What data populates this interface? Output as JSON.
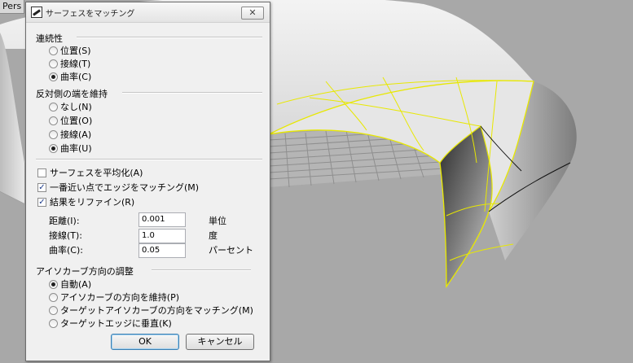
{
  "viewport": {
    "tab_label": "Pers"
  },
  "dialog": {
    "title": "サーフェスをマッチング",
    "close_glyph": "✕",
    "continuity": {
      "heading": "連続性",
      "options": [
        {
          "label": "位置(S)",
          "selected": false
        },
        {
          "label": "接線(T)",
          "selected": false
        },
        {
          "label": "曲率(C)",
          "selected": true
        }
      ]
    },
    "opposite_edge": {
      "heading": "反対側の端を維持",
      "options": [
        {
          "label": "なし(N)",
          "selected": false
        },
        {
          "label": "位置(O)",
          "selected": false
        },
        {
          "label": "接線(A)",
          "selected": false
        },
        {
          "label": "曲率(U)",
          "selected": true
        }
      ]
    },
    "checkboxes": [
      {
        "label": "サーフェスを平均化(A)",
        "checked": false
      },
      {
        "label": "一番近い点でエッジをマッチング(M)",
        "checked": true
      },
      {
        "label": "結果をリファイン(R)",
        "checked": true
      }
    ],
    "refine": {
      "distance": {
        "label": "距離(I):",
        "value": "0.001",
        "unit": "単位"
      },
      "tangent": {
        "label": "接線(T):",
        "value": "1.0",
        "unit": "度"
      },
      "curvature": {
        "label": "曲率(C):",
        "value": "0.05",
        "unit": "パーセント"
      }
    },
    "isocurve": {
      "heading": "アイソカーブ方向の調整",
      "options": [
        {
          "label": "自動(A)",
          "selected": true
        },
        {
          "label": "アイソカーブの方向を維持(P)",
          "selected": false
        },
        {
          "label": "ターゲットアイソカーブの方向をマッチング(M)",
          "selected": false
        },
        {
          "label": "ターゲットエッジに垂直(K)",
          "selected": false
        }
      ]
    },
    "ok_label": "OK",
    "cancel_label": "キャンセル"
  }
}
